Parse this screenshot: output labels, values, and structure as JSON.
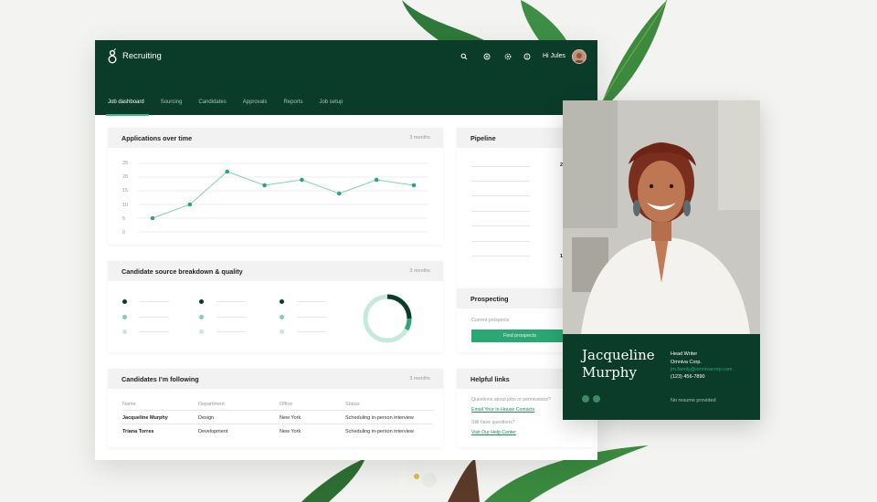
{
  "app": {
    "title": "Recruiting",
    "greeting": "Hi Jules",
    "tabs": [
      "Job dashboard",
      "Sourcing",
      "Candidates",
      "Approvals",
      "Reports",
      "Job setup"
    ]
  },
  "applications_card": {
    "title": "Applications over time",
    "period": "3 months"
  },
  "chart_data": {
    "type": "line",
    "title": "Applications over time",
    "x": [
      1,
      2,
      3,
      4,
      5,
      6,
      7,
      8
    ],
    "values": [
      5,
      10,
      22,
      17,
      19,
      14,
      19,
      17
    ],
    "yticks": [
      "25",
      "20",
      "15",
      "10",
      "5",
      "0"
    ],
    "ylim": [
      0,
      25
    ],
    "grid": true,
    "color": "#2aa774"
  },
  "source_card": {
    "title": "Candidate source breakdown & quality",
    "period": "3 months"
  },
  "following_card": {
    "title": "Candidates I’m following",
    "period": "3 months",
    "headers": [
      "Name",
      "Department",
      "Office",
      "Status"
    ],
    "rows": [
      [
        "Jacqueline Murphy",
        "Design",
        "New York",
        "Scheduling in-person interview"
      ],
      [
        "Triana Torres",
        "Development",
        "New York",
        "Scheduling in-person interview"
      ]
    ]
  },
  "pipeline_card": {
    "title": "Pipeline",
    "partial_values": [
      "2",
      "1"
    ]
  },
  "prospecting_card": {
    "title": "Prospecting",
    "label": "Current prospects",
    "button": "Find prospects"
  },
  "help_card": {
    "title": "Helpful links",
    "q1": "Questions about jobs or permissions?",
    "l1": "Email Your In-House Contacts",
    "q2": "Still have questions?",
    "l2": "Visit Our Help Center"
  },
  "profile": {
    "first": "Jacqueline",
    "last": "Murphy",
    "role": "Head Writer",
    "company": "Omniva Corp.",
    "email": "jm.family@omnivacorp.com",
    "phone": "(123) 456-7890",
    "note": "No resume provided"
  },
  "colors": {
    "brand": "#0b3c2a",
    "accent": "#2aa774",
    "dark_dot": "#0b3c2a",
    "mid_dot": "#7fcdb0",
    "light_dot": "#c5e9dc"
  }
}
